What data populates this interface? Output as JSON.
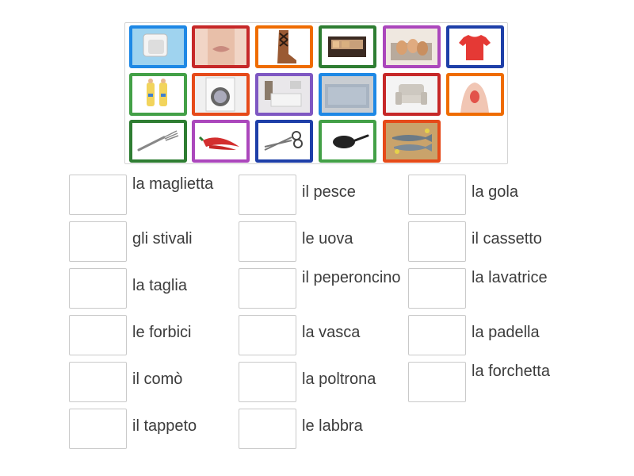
{
  "tiles": [
    {
      "icon": "bathtub-icon",
      "border": "#1e88e5"
    },
    {
      "icon": "lips-icon",
      "border": "#c62828"
    },
    {
      "icon": "boots-icon",
      "border": "#ef6c00"
    },
    {
      "icon": "drawer-icon",
      "border": "#2e7d32"
    },
    {
      "icon": "eggs-icon",
      "border": "#ab47bc"
    },
    {
      "icon": "tshirt-icon",
      "border": "#1e3fa8"
    },
    {
      "icon": "clothing-sizes-icon",
      "border": "#43a047"
    },
    {
      "icon": "washing-machine-icon",
      "border": "#e64a19"
    },
    {
      "icon": "dresser-icon",
      "border": "#7e57c2"
    },
    {
      "icon": "rug-icon",
      "border": "#1e88e5"
    },
    {
      "icon": "armchair-icon",
      "border": "#c62828"
    },
    {
      "icon": "throat-icon",
      "border": "#ef6c00"
    },
    {
      "icon": "fork-icon",
      "border": "#2e7d32"
    },
    {
      "icon": "chili-pepper-icon",
      "border": "#ab47bc"
    },
    {
      "icon": "scissors-icon",
      "border": "#1e3fa8"
    },
    {
      "icon": "frying-pan-icon",
      "border": "#43a047"
    },
    {
      "icon": "fish-icon",
      "border": "#e64a19"
    }
  ],
  "columns": [
    [
      "la maglietta",
      "gli stivali",
      "la taglia",
      "le forbici",
      "il comò",
      "il tappeto"
    ],
    [
      "il pesce",
      "le uova",
      "il peperoncino",
      "la vasca",
      "la poltrona",
      "le labbra"
    ],
    [
      "la gola",
      "il cassetto",
      "la lavatrice",
      "la padella",
      "la forchetta"
    ]
  ]
}
